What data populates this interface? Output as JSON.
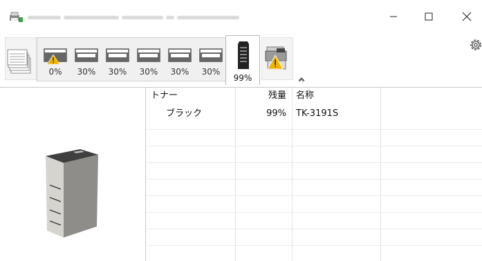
{
  "window": {
    "title_blurred": true,
    "minimize_icon": "minimize-icon",
    "maximize_icon": "maximize-icon",
    "close_icon": "close-icon"
  },
  "toolbar": {
    "trays": [
      {
        "level": "0%",
        "warning": true
      },
      {
        "level": "30%",
        "warning": false
      },
      {
        "level": "30%",
        "warning": false
      },
      {
        "level": "30%",
        "warning": false
      },
      {
        "level": "30%",
        "warning": false
      },
      {
        "level": "30%",
        "warning": false
      }
    ],
    "toner_level": "99%",
    "settings_icon": "gear-icon",
    "collapse_icon": "chevron-up-icon"
  },
  "table": {
    "headers": {
      "item": "トナー",
      "remaining": "残量",
      "name": "名称"
    },
    "rows": [
      {
        "item": "ブラック",
        "remaining": "99%",
        "name": "TK-3191S"
      }
    ]
  },
  "colors": {
    "warning": "#f0b400",
    "selected_tab_border": "#b8b8b8"
  }
}
